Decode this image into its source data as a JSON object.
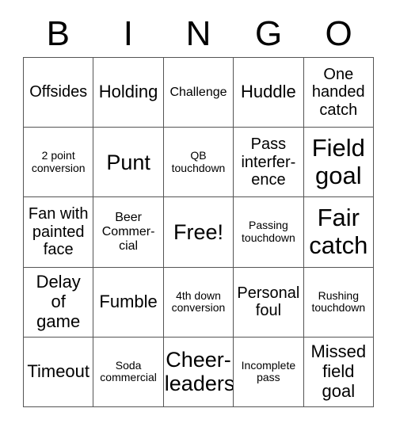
{
  "card": {
    "title_letters": [
      "B",
      "I",
      "N",
      "G",
      "O"
    ],
    "columns": 5,
    "rows": 5,
    "free_space": "Free!",
    "border_color": "#555555",
    "background_color": "#ffffff",
    "text_color": "#000000",
    "squares": [
      [
        {
          "text": "Offsides",
          "size": "lg"
        },
        {
          "text": "Holding",
          "size": "xl"
        },
        {
          "text": "Challenge",
          "size": "md"
        },
        {
          "text": "Huddle",
          "size": "xl"
        },
        {
          "text": "One\nhanded\ncatch",
          "size": "lg"
        }
      ],
      [
        {
          "text": "2 point\nconversion",
          "size": "sm"
        },
        {
          "text": "Punt",
          "size": "xxl"
        },
        {
          "text": "QB\ntouchdown",
          "size": "sm"
        },
        {
          "text": "Pass\ninterfer-\nence",
          "size": "lg"
        },
        {
          "text": "Field\ngoal",
          "size": "huge"
        }
      ],
      [
        {
          "text": "Fan with\npainted\nface",
          "size": "lg"
        },
        {
          "text": "Beer\nCommer-\ncial",
          "size": "md"
        },
        {
          "text": "Free!",
          "size": "xxl"
        },
        {
          "text": "Passing\ntouchdown",
          "size": "sm"
        },
        {
          "text": "Fair\ncatch",
          "size": "huge"
        }
      ],
      [
        {
          "text": "Delay\nof\ngame",
          "size": "xl"
        },
        {
          "text": "Fumble",
          "size": "xl"
        },
        {
          "text": "4th down\nconversion",
          "size": "sm"
        },
        {
          "text": "Personal\nfoul",
          "size": "lg"
        },
        {
          "text": "Rushing\ntouchdown",
          "size": "sm"
        }
      ],
      [
        {
          "text": "Timeout",
          "size": "xl"
        },
        {
          "text": "Soda\ncommercial",
          "size": "sm"
        },
        {
          "text": "Cheer-\nleaders",
          "size": "xxl"
        },
        {
          "text": "Incomplete\npass",
          "size": "sm"
        },
        {
          "text": "Missed\nfield\ngoal",
          "size": "xl"
        }
      ]
    ]
  }
}
